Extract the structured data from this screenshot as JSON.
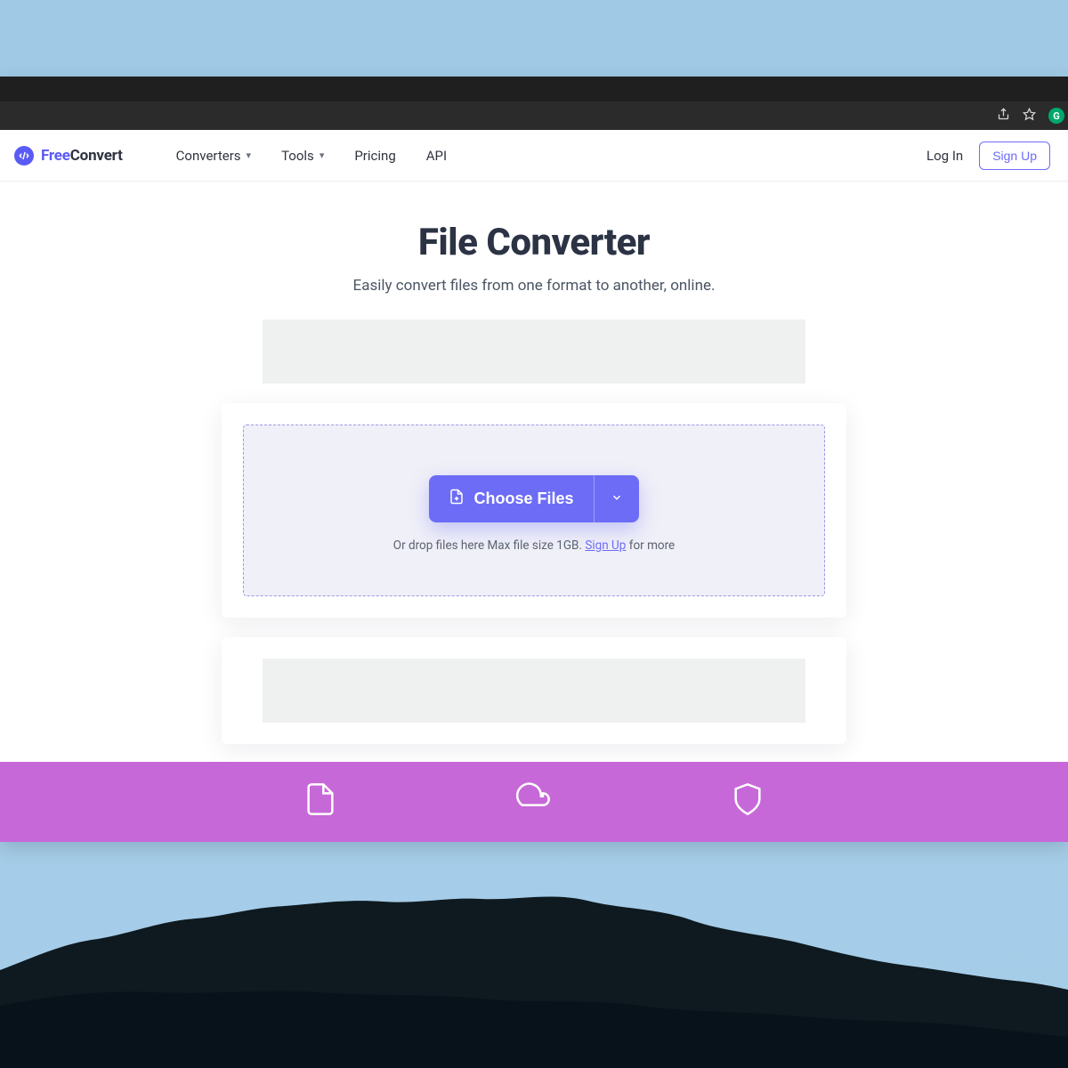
{
  "brand": {
    "part1": "Free",
    "part2": "Convert"
  },
  "nav": {
    "converters": "Converters",
    "tools": "Tools",
    "pricing": "Pricing",
    "api": "API"
  },
  "auth": {
    "login": "Log In",
    "signup": "Sign Up"
  },
  "hero": {
    "title": "File Converter",
    "subtitle": "Easily convert files from one format to another, online."
  },
  "upload": {
    "choose_label": "Choose Files",
    "drop_prefix": "Or drop files here Max file size 1GB. ",
    "signup_link": "Sign Up",
    "drop_suffix": " for more"
  },
  "colors": {
    "accent": "#6c6cf7",
    "band": "#c768d8"
  }
}
